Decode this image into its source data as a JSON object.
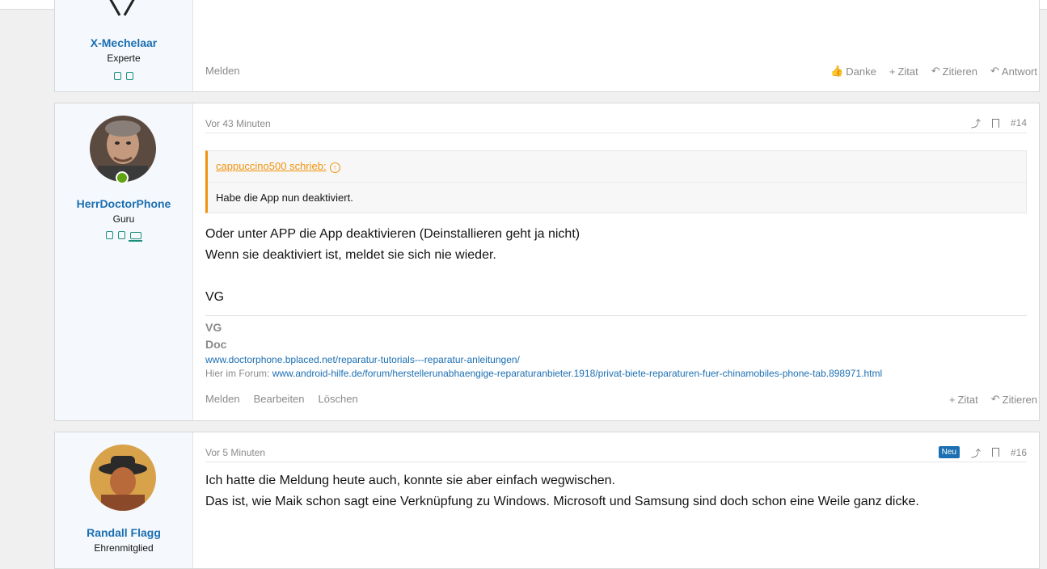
{
  "post1": {
    "username": "X-Mechelaar",
    "usertitle": "Experte",
    "actions_left": [
      "Melden"
    ],
    "actions_right": [
      {
        "icon": "thumbs-up-icon",
        "symbol": "👍",
        "label": "Danke"
      },
      {
        "icon": "plus-icon",
        "symbol": "+",
        "label": "Zitat"
      },
      {
        "icon": "reply-icon",
        "symbol": "↶",
        "label": "Zitieren"
      },
      {
        "icon": "reply-icon",
        "symbol": "↶",
        "label": "Antwort"
      }
    ]
  },
  "post2": {
    "username": "HerrDoctorPhone",
    "usertitle": "Guru",
    "time": "Vor 43 Minuten",
    "post_number": "#14",
    "quote": {
      "author": "cappuccino500 schrieb:",
      "text": "Habe die App nun deaktiviert."
    },
    "message": [
      "Oder unter APP die App deaktivieren (Deinstallieren geht ja nicht)",
      "Wenn sie deaktiviert ist, meldet sie sich nie wieder.",
      "VG"
    ],
    "signature": {
      "line1": "VG",
      "line2": "Doc",
      "link1": "www.doctorphone.bplaced.net/reparatur-tutorials---reparatur-anleitungen/",
      "forum_prefix": "Hier im Forum:",
      "link2": "www.android-hilfe.de/forum/herstellerunabhaengige-reparaturanbieter.1918/privat-biete-reparaturen-fuer-chinamobiles-phone-tab.898971.html"
    },
    "actions_left": [
      "Melden",
      "Bearbeiten",
      "Löschen"
    ],
    "actions_right": [
      {
        "icon": "plus-icon",
        "symbol": "+",
        "label": "Zitat"
      },
      {
        "icon": "reply-icon",
        "symbol": "↶",
        "label": "Zitieren"
      }
    ]
  },
  "post3": {
    "username": "Randall Flagg",
    "usertitle": "Ehrenmitglied",
    "time": "Vor 5 Minuten",
    "badge": "Neu",
    "post_number": "#16",
    "message": [
      "Ich hatte die Meldung heute auch, konnte sie aber einfach wegwischen.",
      "Das ist, wie Maik schon sagt eine Verknüpfung zu Windows. Microsoft und Samsung sind doch schon eine Weile ganz dicke."
    ]
  },
  "colors": {
    "accent_blue": "#1c6fb2",
    "quote_orange": "#f2930d",
    "online_green": "#62a40f",
    "badge_teal": "#1c8f7d"
  }
}
